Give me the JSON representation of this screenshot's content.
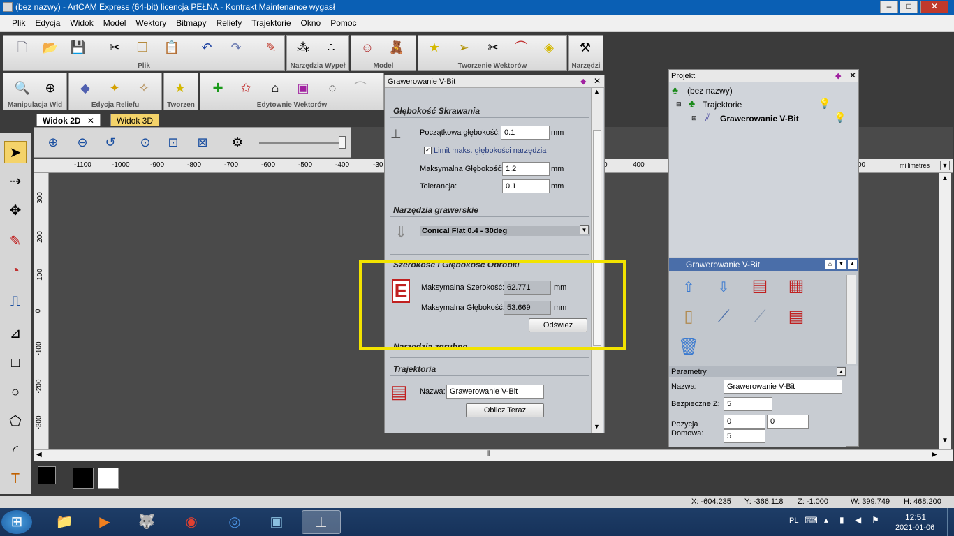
{
  "window": {
    "title": "(bez nazwy) - ArtCAM Express (64-bit) licencja PEŁNA - Kontrakt Maintenance wygasł",
    "min": "–",
    "max": "□",
    "close": "✕"
  },
  "menu": [
    "Plik",
    "Edycja",
    "Widok",
    "Model",
    "Wektory",
    "Bitmapy",
    "Reliefy",
    "Trajektorie",
    "Okno",
    "Pomoc"
  ],
  "toolbar_groups": {
    "plik": "Plik",
    "narzedzia_wypel": "Narzędzia Wypeł",
    "model": "Model",
    "tworzenie_wektorow": "Tworzenie Wektorów",
    "narzedzi": "Narzędzi",
    "manipulacja": "Manipulacja Wid",
    "edycja_reliefu": "Edycja Reliefu",
    "tworzen": "Tworzen",
    "edytownie": "Edytownie Wektorów"
  },
  "view_tabs": {
    "tab2d": "Widok 2D",
    "tab3d": "Widok 3D",
    "close": "✕"
  },
  "ruler": {
    "h": [
      "-1100",
      "-1000",
      "-900",
      "-800",
      "-700",
      "-600",
      "-500",
      "-400",
      "-30",
      "0",
      "400",
      "00"
    ],
    "unit": "millimetres",
    "v": [
      "300",
      "200",
      "100",
      "0",
      "-100",
      "-200",
      "-300"
    ]
  },
  "vbit_panel": {
    "title": "Grawerowanie V-Bit",
    "sec_depth": "Głębokość Skrawania",
    "start_depth_label": "Początkowa głębokość:",
    "start_depth": "0.1",
    "limit_label": "Limit maks. głębokości narzędzia",
    "max_depth_label": "Maksymalna Głębokość:",
    "max_depth": "1.2",
    "tolerance_label": "Tolerancja:",
    "tolerance": "0.1",
    "unit": "mm",
    "sec_tools": "Narzędzia grawerskie",
    "tool_name": "Conical Flat 0.4 - 30deg",
    "sec_width": "Szerokość i Głębokość Obróbki",
    "max_width_label": "Maksymalna Szerokość:",
    "max_width": "62.771",
    "max_depth2_label": "Maksymalna Głębokość:",
    "max_depth2": "53.669",
    "refresh": "Odśwież",
    "sec_rough": "Narzędzia zgrubne",
    "sec_traj": "Trajektoria",
    "name_label": "Nazwa:",
    "name_value": "Grawerowanie V-Bit",
    "calc": "Oblicz Teraz"
  },
  "project": {
    "title": "Projekt",
    "root": "(bez nazwy)",
    "trajektorie": "Trajektorie",
    "item": "Grawerowanie V-Bit",
    "bar": "Grawerowanie V-Bit",
    "params": "Parametry",
    "name_label": "Nazwa:",
    "name_value": "Grawerowanie V-Bit",
    "safe_label": "Bezpieczne Z:",
    "safe_value": "5",
    "home_label1": "Pozycja",
    "home_label2": "Domowa:",
    "home_x": "0",
    "home_y": "0",
    "home_z": "5"
  },
  "status": {
    "x": "X: -604.235",
    "y": "Y: -366.118",
    "z": "Z: -1.000",
    "w": "W: 399.749",
    "h": "H: 468.200"
  },
  "taskbar": {
    "lang": "PL",
    "time": "12:51",
    "date": "2021-01-06"
  },
  "colors": {
    "titlebar": "#0a5fb4",
    "highlight": "#f2e300",
    "selection": "#4a6ea9"
  }
}
